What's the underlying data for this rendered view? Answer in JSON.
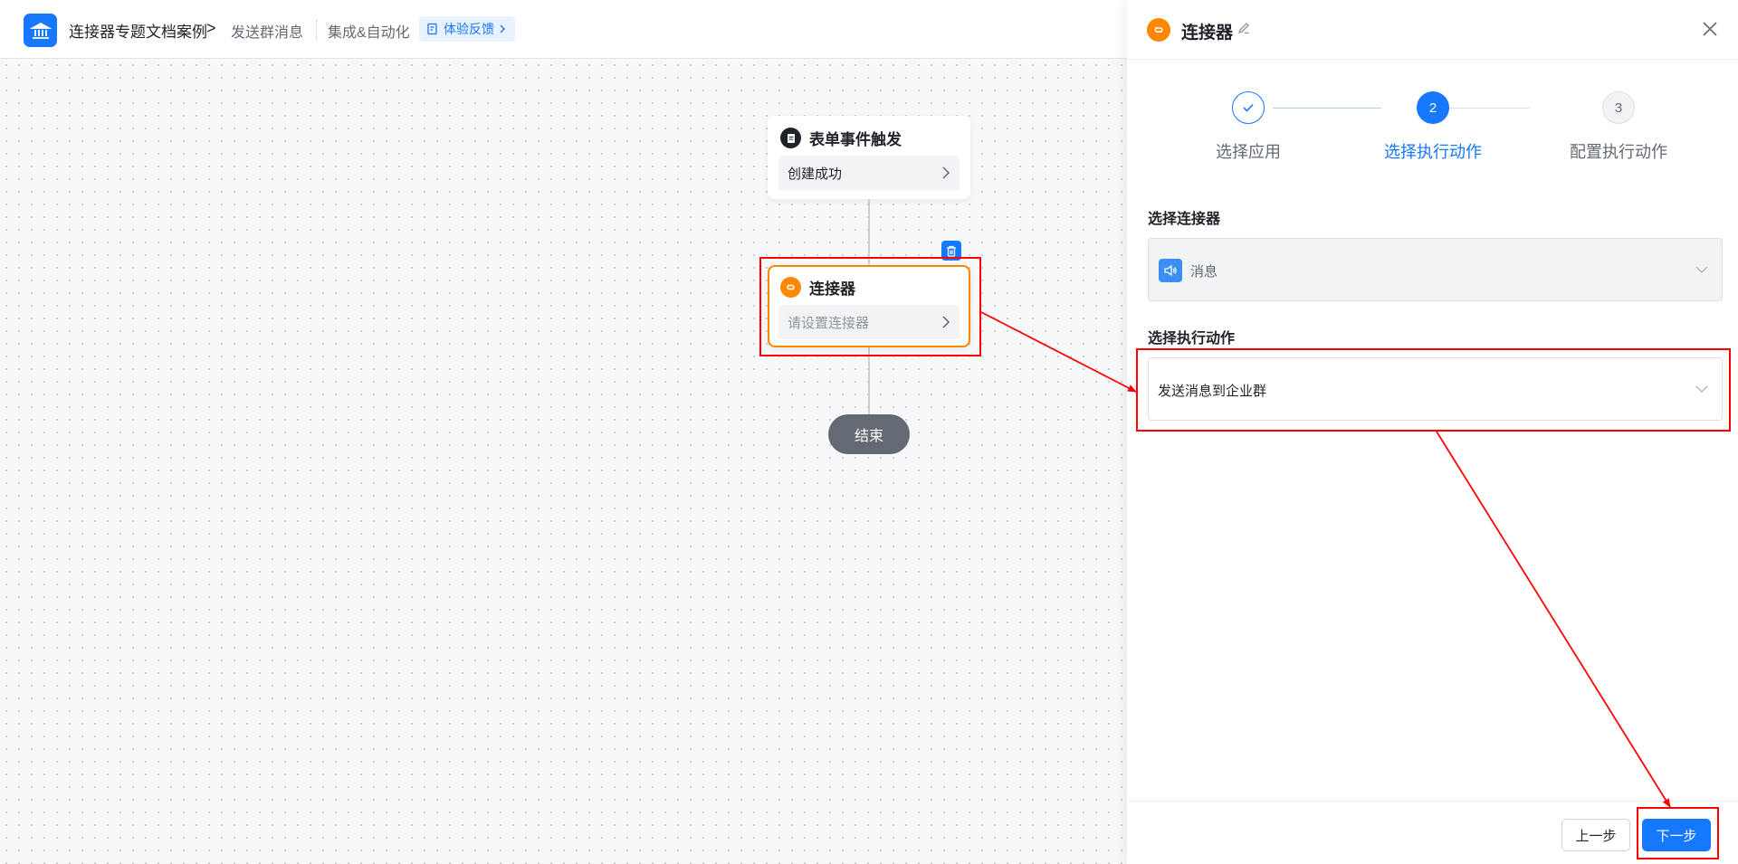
{
  "header": {
    "app_name": "连接器专题文档案例",
    "separator": ">",
    "page_name": "发送群消息",
    "integration_label": "集成&自动化",
    "feedback_label": "体验反馈"
  },
  "canvas": {
    "trigger_node": {
      "title": "表单事件触发",
      "body": "创建成功"
    },
    "connector_node": {
      "title": "连接器",
      "body_placeholder": "请设置连接器"
    },
    "end_node": {
      "label": "结束"
    }
  },
  "panel": {
    "title": "连接器",
    "steps": [
      {
        "number": "",
        "label": "选择应用",
        "state": "done"
      },
      {
        "number": "2",
        "label": "选择执行动作",
        "state": "active"
      },
      {
        "number": "3",
        "label": "配置执行动作",
        "state": "pending"
      }
    ],
    "connector_section": {
      "label": "选择连接器",
      "value": "消息"
    },
    "action_section": {
      "label": "选择执行动作",
      "value": "发送消息到企业群"
    },
    "footer": {
      "prev_label": "上一步",
      "next_label": "下一步"
    }
  },
  "colors": {
    "primary": "#1677ff",
    "connector_orange": "#ff8800",
    "annotation_red": "#ff0000"
  }
}
